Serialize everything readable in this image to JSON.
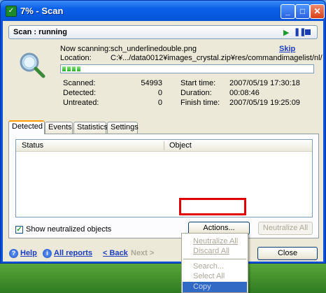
{
  "window": {
    "title": "7% - Scan",
    "minimize": "_",
    "maximize": "□",
    "close": "✕"
  },
  "status": {
    "label": "Scan : running"
  },
  "scan": {
    "now_scanning_label": "Now scanning:",
    "now_scanning_value": "sch_underlinedouble.png",
    "skip_label": "Skip",
    "location_label": "Location:",
    "location_value": "C:¥.../data0012¥images_crystal.zip¥res/commandimagelist/nl/",
    "progress_percent": 7
  },
  "stats": {
    "scanned_label": "Scanned:",
    "scanned_value": "54993",
    "detected_label": "Detected:",
    "detected_value": "0",
    "untreated_label": "Untreated:",
    "untreated_value": "0",
    "start_label": "Start time:",
    "start_value": "2007/05/19 17:30:18",
    "duration_label": "Duration:",
    "duration_value": "00:08:46",
    "finish_label": "Finish time:",
    "finish_value": "2007/05/19 19:25:09"
  },
  "tabs": [
    {
      "label": "Detected",
      "active": true
    },
    {
      "label": "Events"
    },
    {
      "label": "Statistics"
    },
    {
      "label": "Settings"
    }
  ],
  "list": {
    "columns": [
      "Status",
      "Object"
    ]
  },
  "options": {
    "show_neutralized_label": "Show neutralized objects",
    "show_neutralized_checked": true
  },
  "buttons": {
    "actions": "Actions...",
    "neutralize_all": "Neutralize All",
    "close": "Close"
  },
  "footer": {
    "help": "Help",
    "all_reports": "All reports",
    "back": "< Back",
    "next": "Next >"
  },
  "menu": {
    "items": [
      "Neutralize All",
      "Discard All",
      "Search...",
      "Select All",
      "Copy"
    ]
  },
  "colors": {
    "accent": "#1a3cc0",
    "highlight_frame": "#e00000",
    "title_bar": "#0a5fe8"
  }
}
